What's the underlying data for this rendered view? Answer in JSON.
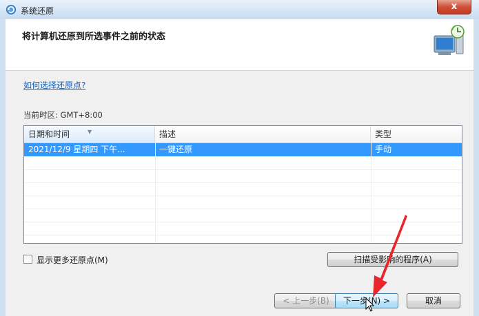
{
  "window": {
    "title": "系统还原",
    "close_glyph": "x"
  },
  "header": {
    "title": "将计算机还原到所选事件之前的状态"
  },
  "help_link": "如何选择还原点?",
  "timezone_label": "当前时区: GMT+8:00",
  "table": {
    "columns": [
      "日期和时间",
      "描述",
      "类型"
    ],
    "rows": [
      {
        "date": "2021/12/9 星期四 下午...",
        "description": "一键还原",
        "type": "手动",
        "selected": true
      }
    ]
  },
  "show_more_checkbox": {
    "label": "显示更多还原点(M)",
    "checked": false
  },
  "buttons": {
    "scan": "扫描受影响的程序(A)",
    "back": "< 上一步(B)",
    "next": "下一步(N) >",
    "cancel": "取消"
  },
  "colors": {
    "selection": "#3399ff",
    "link": "#1a5fb4",
    "annotation_arrow": "#e8262c",
    "close_button": "#c9452f"
  }
}
